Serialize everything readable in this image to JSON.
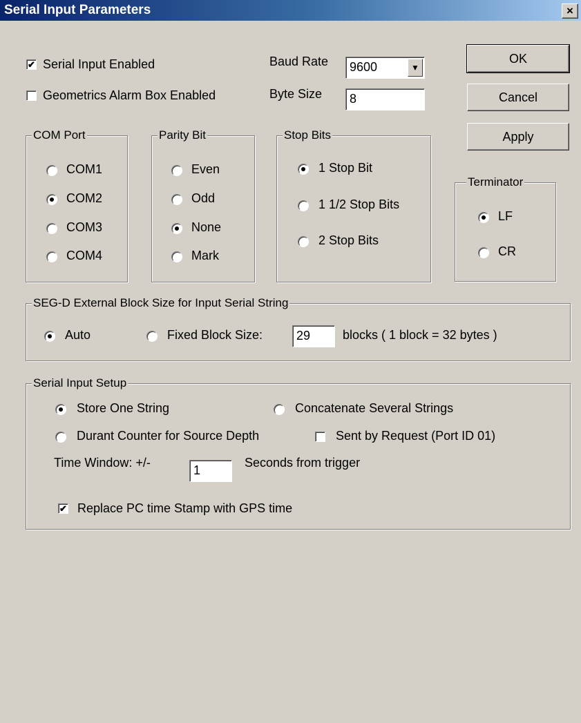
{
  "window": {
    "title": "Serial Input Parameters",
    "close_symbol": "×"
  },
  "buttons": {
    "ok": "OK",
    "cancel": "Cancel",
    "apply": "Apply"
  },
  "top": {
    "serial_input_enabled": {
      "label": "Serial Input Enabled",
      "checked": true
    },
    "geometrics_alarm": {
      "label": "Geometrics Alarm Box Enabled",
      "checked": false
    },
    "baud_rate": {
      "label": "Baud Rate",
      "value": "9600"
    },
    "byte_size": {
      "label": "Byte Size",
      "value": "8"
    }
  },
  "com_port": {
    "legend": "COM Port",
    "options": [
      "COM1",
      "COM2",
      "COM3",
      "COM4"
    ],
    "selected": "COM2"
  },
  "parity": {
    "legend": "Parity Bit",
    "options": [
      "Even",
      "Odd",
      "None",
      "Mark"
    ],
    "selected": "None"
  },
  "stop_bits": {
    "legend": "Stop Bits",
    "options": [
      "1 Stop Bit",
      "1 1/2 Stop Bits",
      "2 Stop Bits"
    ],
    "selected": "1 Stop Bit"
  },
  "terminator": {
    "legend": "Terminator",
    "options": [
      "LF",
      "CR"
    ],
    "selected": "LF"
  },
  "segd": {
    "legend": "SEG-D External Block Size for Input Serial String",
    "auto_label": "Auto",
    "fixed_label": "Fixed Block Size:",
    "block_value": "29",
    "block_suffix": "blocks ( 1 block = 32 bytes )",
    "selected": "Auto"
  },
  "setup": {
    "legend": "Serial Input Setup",
    "store_one": "Store One String",
    "concatenate": "Concatenate Several Strings",
    "durant": "Durant Counter for Source Depth",
    "sent_by_request": "Sent by Request (Port ID 01)",
    "sent_by_request_checked": false,
    "time_window_label": "Time Window:  +/-",
    "time_window_value": "1",
    "time_window_suffix": "Seconds from trigger",
    "replace_gps": "Replace PC time Stamp with GPS time",
    "replace_gps_checked": true,
    "selected": "Store One String"
  },
  "colors": {
    "face": "#d4d0c8",
    "title_start": "#0a246a",
    "title_end": "#a6caf0"
  },
  "icons": {
    "check": "✔",
    "dropdown": "▼"
  }
}
